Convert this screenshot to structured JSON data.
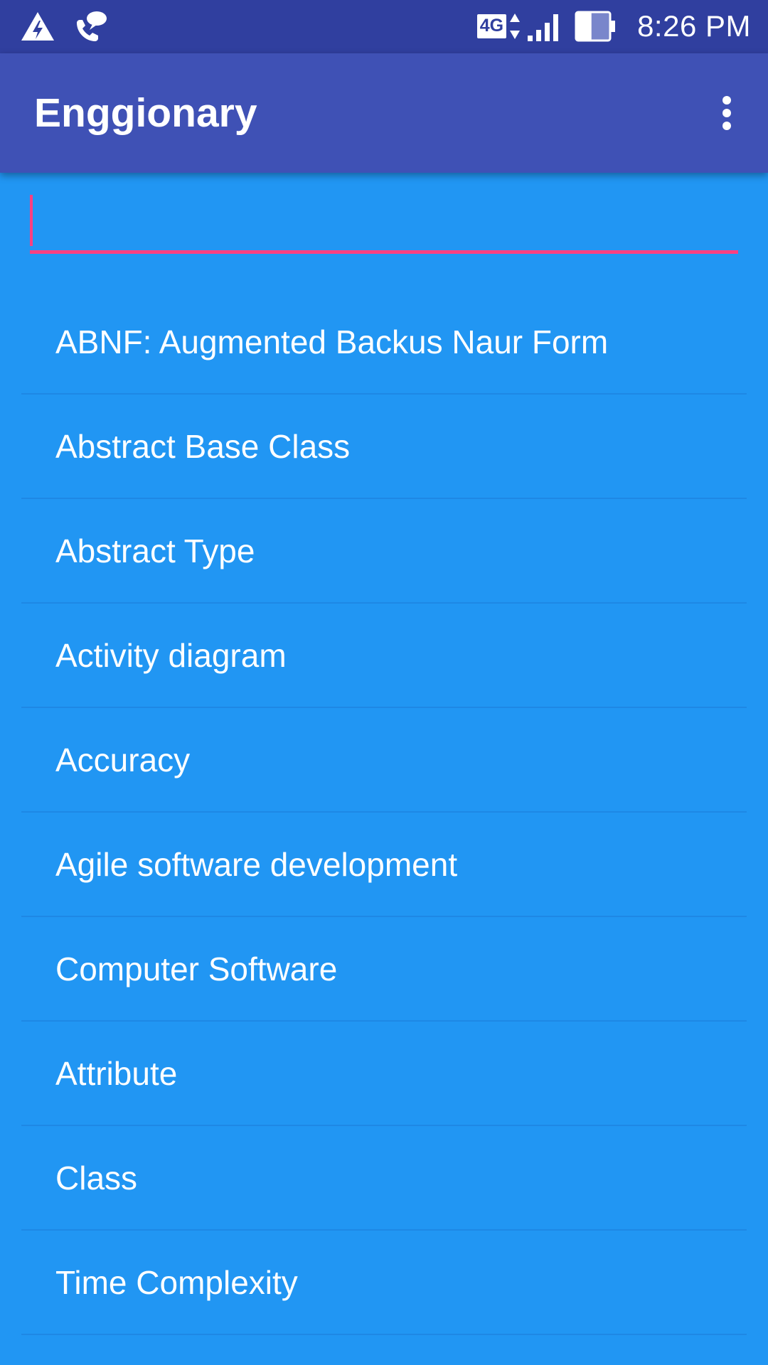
{
  "status_bar": {
    "time": "8:26 PM",
    "network_type": "4G",
    "icons": [
      "warning-flash-icon",
      "wifi-calling-icon",
      "network-4g-icon",
      "data-arrows-icon",
      "signal-icon",
      "battery-icon"
    ],
    "battery_level": 0.45,
    "signal_bars": 4
  },
  "app_bar": {
    "title": "Enggionary",
    "menu_icon": "more-vert-icon"
  },
  "search": {
    "value": "",
    "placeholder": ""
  },
  "terms": [
    {
      "label": "ABNF: Augmented Backus Naur Form"
    },
    {
      "label": "Abstract Base Class"
    },
    {
      "label": "Abstract Type"
    },
    {
      "label": "Activity diagram"
    },
    {
      "label": "Accuracy"
    },
    {
      "label": "Agile software development"
    },
    {
      "label": "Computer Software"
    },
    {
      "label": "Attribute"
    },
    {
      "label": "Class"
    },
    {
      "label": "Time Complexity"
    }
  ],
  "colors": {
    "status_bar": "#303F9F",
    "app_bar": "#3F51B5",
    "background": "#2196F3",
    "accent": "#FF4081",
    "divider": "#1E88E5",
    "text": "#FFFFFF"
  }
}
